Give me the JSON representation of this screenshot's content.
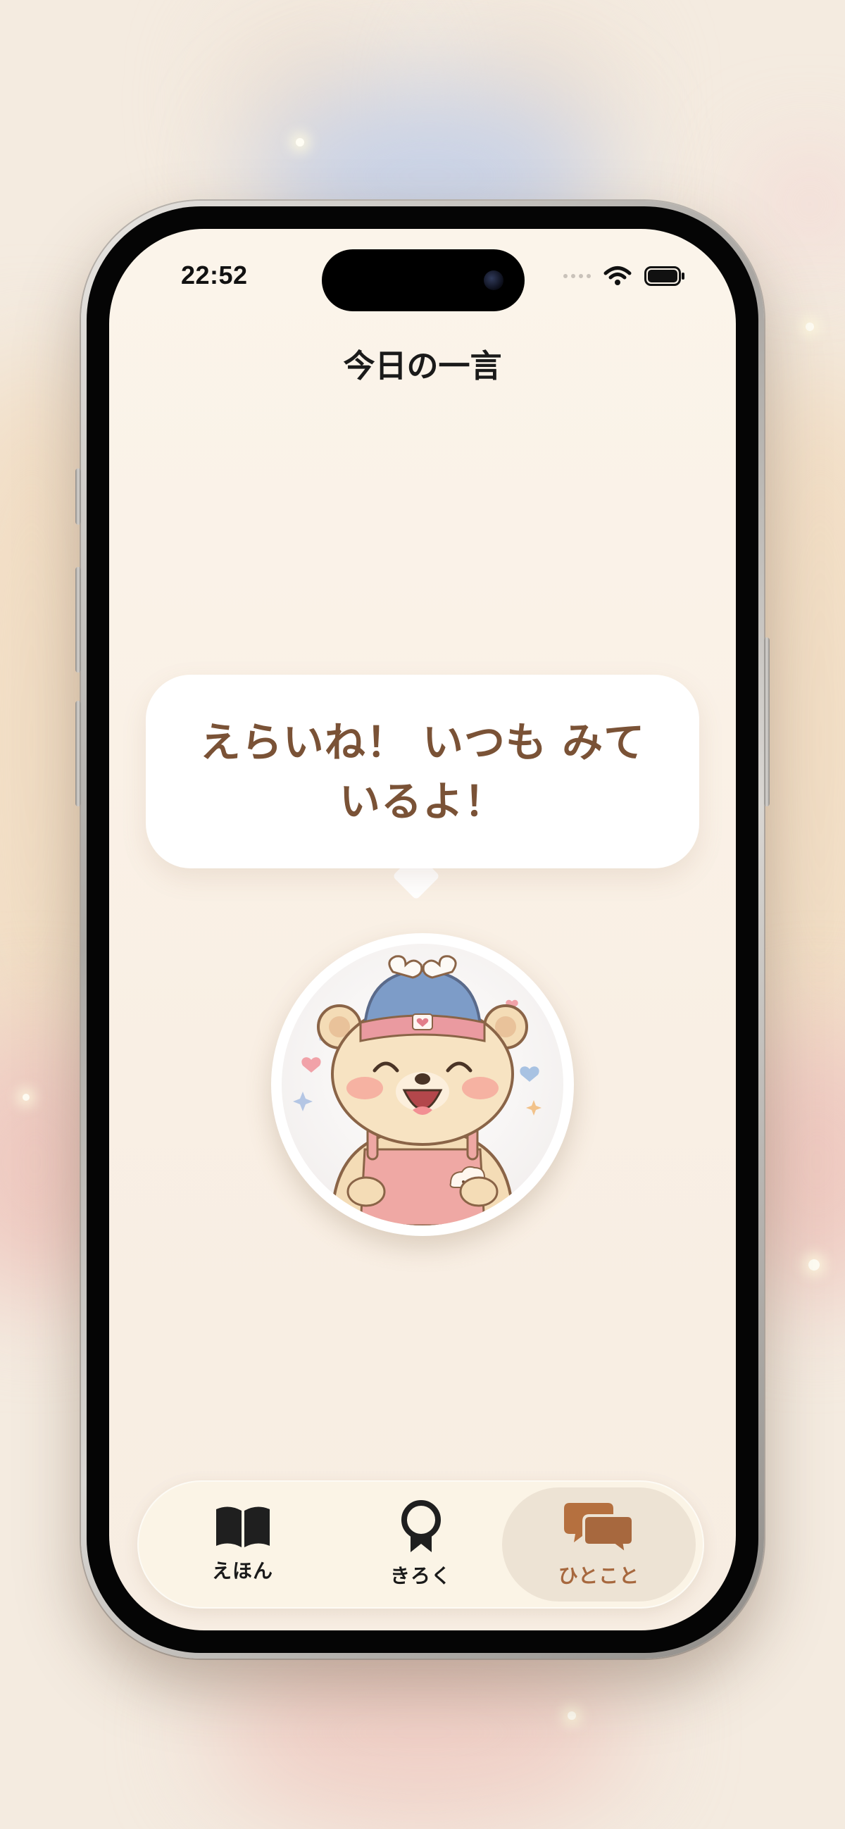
{
  "status_bar": {
    "time": "22:52"
  },
  "header": {
    "title": "今日の一言"
  },
  "message": {
    "text": "えらいね！ いつも みて いるよ！"
  },
  "avatar": {
    "description_icon": "bear-character-icon"
  },
  "tab_bar": {
    "active_color": "#a7683e",
    "tabs": [
      {
        "label": "えほん",
        "icon": "open-book-icon",
        "active": false
      },
      {
        "label": "きろく",
        "icon": "award-ribbon-icon",
        "active": false
      },
      {
        "label": "ひとこと",
        "icon": "speech-bubbles-icon",
        "active": true
      }
    ]
  }
}
